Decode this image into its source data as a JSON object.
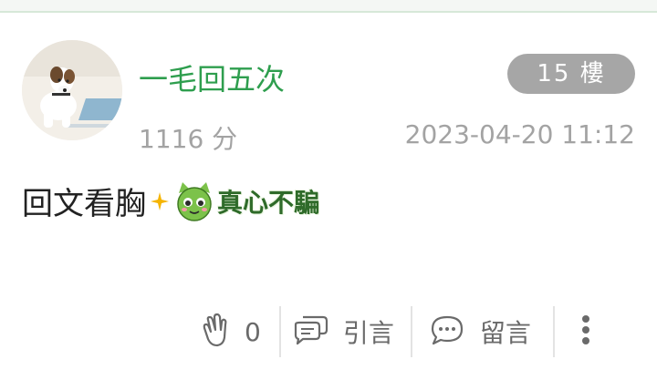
{
  "post": {
    "username": "一毛回五次",
    "floor_label": "15 樓",
    "score": "1116 分",
    "timestamp": "2023-04-20 11:12",
    "content_text": "回文看胸",
    "sticker_text": "真心不騙"
  },
  "actions": {
    "clap_count": "0",
    "quote_label": "引言",
    "reply_label": "留言"
  },
  "colors": {
    "username": "#2e9e4e",
    "floor_badge": "#a6a6a6",
    "meta_text": "#a3a3a3",
    "action_text": "#6a6a6a"
  },
  "icons": [
    "clap-icon",
    "quote-bubble-icon",
    "reply-bubble-icon",
    "more-vertical-icon",
    "sparkle-icon",
    "green-cat-sticker"
  ]
}
